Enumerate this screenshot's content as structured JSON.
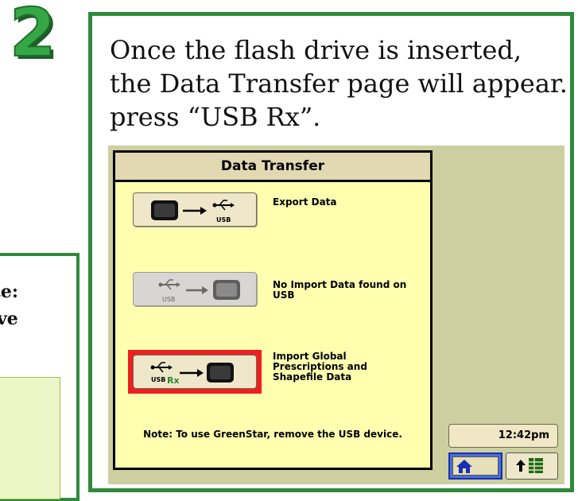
{
  "step": {
    "number": "2"
  },
  "note_panel": {
    "text_line1": "ote:",
    "text_line2": "rive"
  },
  "instruction": {
    "text": "Once the flash drive is inserted, the Data Transfer page will appear. press “USB Rx”."
  },
  "dialog": {
    "title": "Data Transfer",
    "rows": [
      {
        "label": "Export Data",
        "icon": "export-display-to-usb-icon",
        "usb_text": "USB",
        "enabled": true,
        "selected": false
      },
      {
        "label": "No Import Data found on\nUSB",
        "icon": "import-usb-to-display-icon",
        "usb_text": "USB",
        "enabled": false,
        "selected": false
      },
      {
        "label": "Import Global\nPrescriptions and\nShapefile Data",
        "icon": "usb-rx-to-display-icon",
        "usb_text": "USB",
        "rx_text": "Rx",
        "enabled": true,
        "selected": true
      }
    ],
    "note": "Note: To use GreenStar, remove the USB device."
  },
  "status": {
    "time": "12:42pm"
  },
  "nav": {
    "home_icon": "home-icon",
    "menu_icon": "menu-up-icon"
  },
  "colors": {
    "frame_green": "#2e8b3b",
    "selection_red": "#ef1f1f",
    "dialog_yellow": "#ffffb0",
    "home_blue": "#4c6fd1",
    "step_green": "#2f9a3a"
  }
}
